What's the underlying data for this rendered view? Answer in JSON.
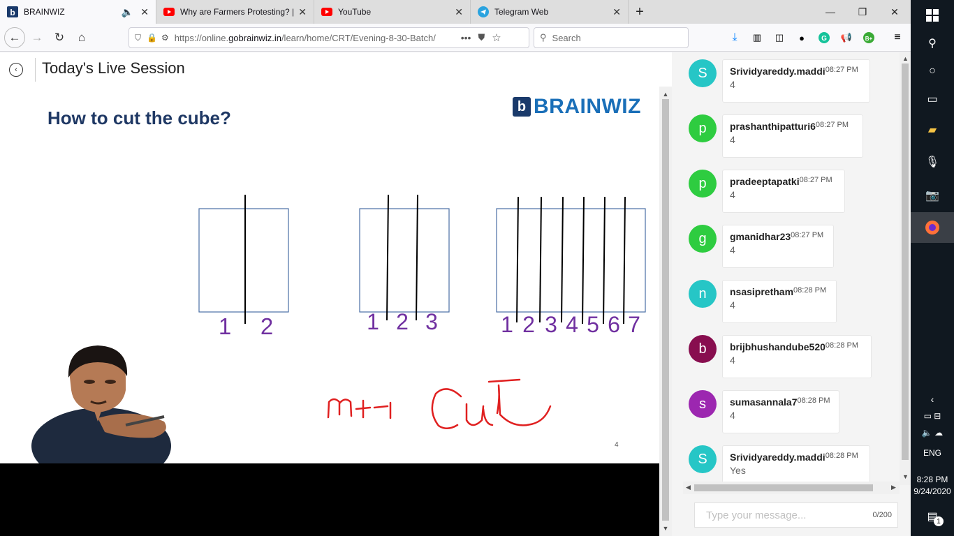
{
  "tabs": [
    {
      "label": "BRAINWIZ",
      "icon": "brainwiz-favicon",
      "active": true
    },
    {
      "label": "Why are Farmers Protesting? | C",
      "icon": "youtube-icon"
    },
    {
      "label": "YouTube",
      "icon": "youtube-icon"
    },
    {
      "label": "Telegram Web",
      "icon": "telegram-icon"
    }
  ],
  "new_tab_label": "+",
  "url": {
    "prefix": "https://online.",
    "domain": "gobrainwiz.in",
    "path": "/learn/home/CRT/Evening-8-30-Batch/"
  },
  "search": {
    "placeholder": "Search"
  },
  "page": {
    "title": "Today's Live Session"
  },
  "slide": {
    "title": "How to cut the cube?",
    "brand": "BRAINWIZ",
    "brand_mark": "b",
    "page_number": "4",
    "diagrams": [
      {
        "numbers": [
          "1",
          "2"
        ]
      },
      {
        "numbers": [
          "1",
          "2",
          "3"
        ]
      },
      {
        "numbers": [
          "1",
          "2",
          "3",
          "4",
          "5",
          "6",
          "7"
        ]
      }
    ],
    "handwriting": "n+1  cut",
    "number_color": "#7030a0",
    "ink_color": "#e02020"
  },
  "chat": {
    "messages": [
      {
        "initial": "S",
        "user": "Srividyareddy.maddi",
        "time": "08:27 PM",
        "text": "4",
        "color": "#26c6c6"
      },
      {
        "initial": "p",
        "user": "prashanthipatturi6",
        "time": "08:27 PM",
        "text": "4",
        "color": "#2ecc40"
      },
      {
        "initial": "p",
        "user": "pradeeptapatki",
        "time": "08:27 PM",
        "text": "4",
        "color": "#2ecc40"
      },
      {
        "initial": "g",
        "user": "gmanidhar23",
        "time": "08:27 PM",
        "text": "4",
        "color": "#2ecc40"
      },
      {
        "initial": "n",
        "user": "nsasipretham",
        "time": "08:28 PM",
        "text": "4",
        "color": "#26c6c6"
      },
      {
        "initial": "b",
        "user": "brijbhushandube520",
        "time": "08:28 PM",
        "text": "4",
        "color": "#880e4f"
      },
      {
        "initial": "s",
        "user": "sumasannala7",
        "time": "08:28 PM",
        "text": "4",
        "color": "#9c27b0"
      },
      {
        "initial": "S",
        "user": "Srividyareddy.maddi",
        "time": "08:28 PM",
        "text": "Yes",
        "color": "#26c6c6"
      }
    ],
    "input_placeholder": "Type your message...",
    "char_count": "0/200"
  },
  "taskbar": {
    "language": "ENG",
    "time": "8:28 PM",
    "date": "9/24/2020",
    "notification_count": "1"
  }
}
